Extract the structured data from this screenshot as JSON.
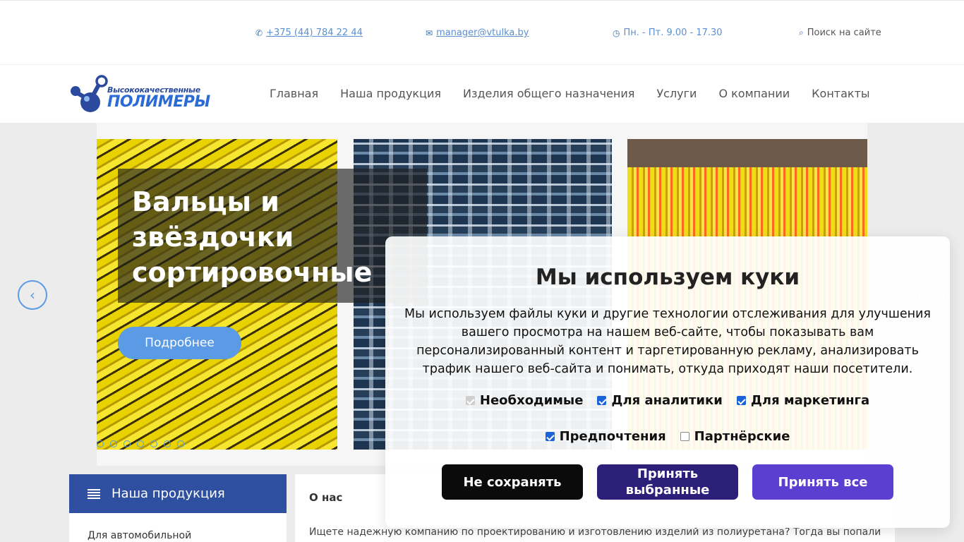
{
  "topbar": {
    "phone": "+375 (44) 784 22 44",
    "email": "manager@vtulka.by",
    "hours": "Пн. - Пт. 9.00 - 17.30",
    "search": "Поиск на сайте"
  },
  "logo": {
    "small": "Высококачественные",
    "big": "ПОЛИМЕРЫ"
  },
  "nav": [
    "Главная",
    "Наша продукция",
    "Изделия общего назначения",
    "Услуги",
    "О компании",
    "Контакты"
  ],
  "slider": {
    "title": "Вальцы и\nзвёздочки\nсортировочные",
    "button": "Подробнее",
    "slide_count": 8,
    "active_slide": 1
  },
  "sidebar": {
    "title": "Наша продукция",
    "first_item": "Для автомобильной"
  },
  "about": {
    "title": "О нас",
    "text": "Ищете надежную компанию по проектированию и изготовлению изделий из полиуретана? Тогда вы попали"
  },
  "cookie": {
    "title": "Мы используем куки",
    "text": "Мы используем файлы куки и другие технологии отслеживания для улучшения вашего просмотра на нашем веб-сайте, чтобы показывать вам персонализированный контент и таргетированную рекламу, анализировать трафик нашего веб-сайта и понимать, откуда приходят наши посетители.",
    "options": [
      {
        "label": "Необходимые",
        "checked": true,
        "disabled": true
      },
      {
        "label": "Для аналитики",
        "checked": true,
        "disabled": false
      },
      {
        "label": "Для маркетинга",
        "checked": true,
        "disabled": false
      },
      {
        "label": "Предпочтения",
        "checked": true,
        "disabled": false
      },
      {
        "label": "Партнёрские",
        "checked": false,
        "disabled": false
      }
    ],
    "buttons": {
      "reject": "Не сохранять",
      "accept_selected": "Принять выбранные",
      "accept_all": "Принять все"
    }
  },
  "colors": {
    "accent": "#5b9be6",
    "brand": "#2f4fa0",
    "accept_all": "#5b3fd0"
  }
}
